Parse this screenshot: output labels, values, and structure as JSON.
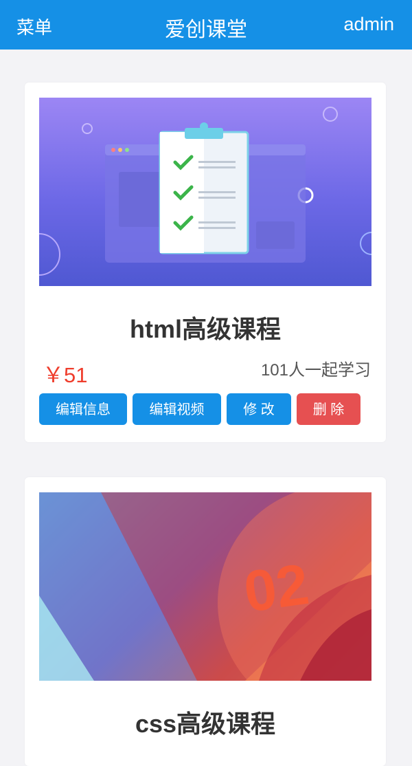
{
  "header": {
    "menu_label": "菜单",
    "title": "爱创课堂",
    "user": "admin",
    "bg_color": "#1590e6"
  },
  "courses": [
    {
      "title": "html高级课程",
      "price": "￥51",
      "students": "101人一起学习",
      "buttons": {
        "edit_info": "编辑信息",
        "edit_video": "编辑视频",
        "modify": "修 改",
        "delete": "删 除"
      },
      "image_icon": "checklist-clipboard-illustration"
    },
    {
      "title": "css高级课程",
      "image_icon": "abstract-gradient-illustration"
    }
  ],
  "colors": {
    "accent": "#1590e6",
    "danger": "#e65051",
    "price": "#ef3d2c"
  }
}
